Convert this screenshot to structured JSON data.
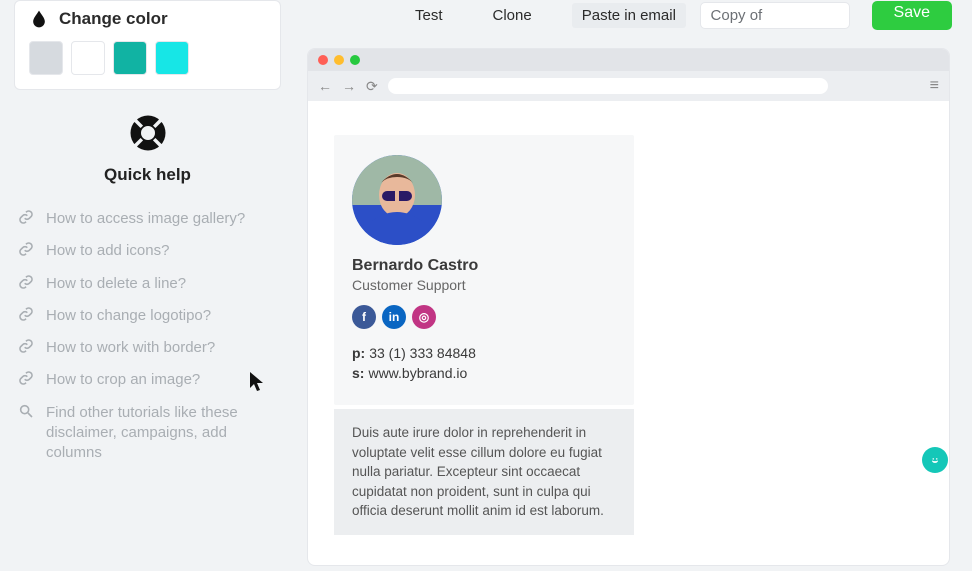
{
  "sidebar": {
    "change_color_title": "Change color",
    "quick_help_title": "Quick help",
    "help_items": [
      "How to access image gallery?",
      "How to add icons?",
      "How to delete a line?",
      "How to change logotipo?",
      "How to work with border?",
      "How to crop an image?"
    ],
    "search_row": "Find other tutorials like these disclaimer, campaigns, add columns"
  },
  "topbar": {
    "tab_test": "Test",
    "tab_clone": "Clone",
    "tab_paste": "Paste in email",
    "copy_of": "Copy of",
    "save": "Save"
  },
  "signature": {
    "name": "Bernardo Castro",
    "role": "Customer Support",
    "phone_label": "p:",
    "phone": "33 (1) 333 84848",
    "site_label": "s:",
    "site": "www.bybrand.io",
    "disclaimer": "Duis aute irure dolor in reprehenderit in voluptate velit esse cillum dolore eu fugiat nulla pariatur. Excepteur sint occaecat cupidatat non proident, sunt in culpa qui officia deserunt mollit anim id est laborum."
  },
  "colors": {
    "teal": "#11b3a3",
    "cyan": "#17e6e6"
  }
}
